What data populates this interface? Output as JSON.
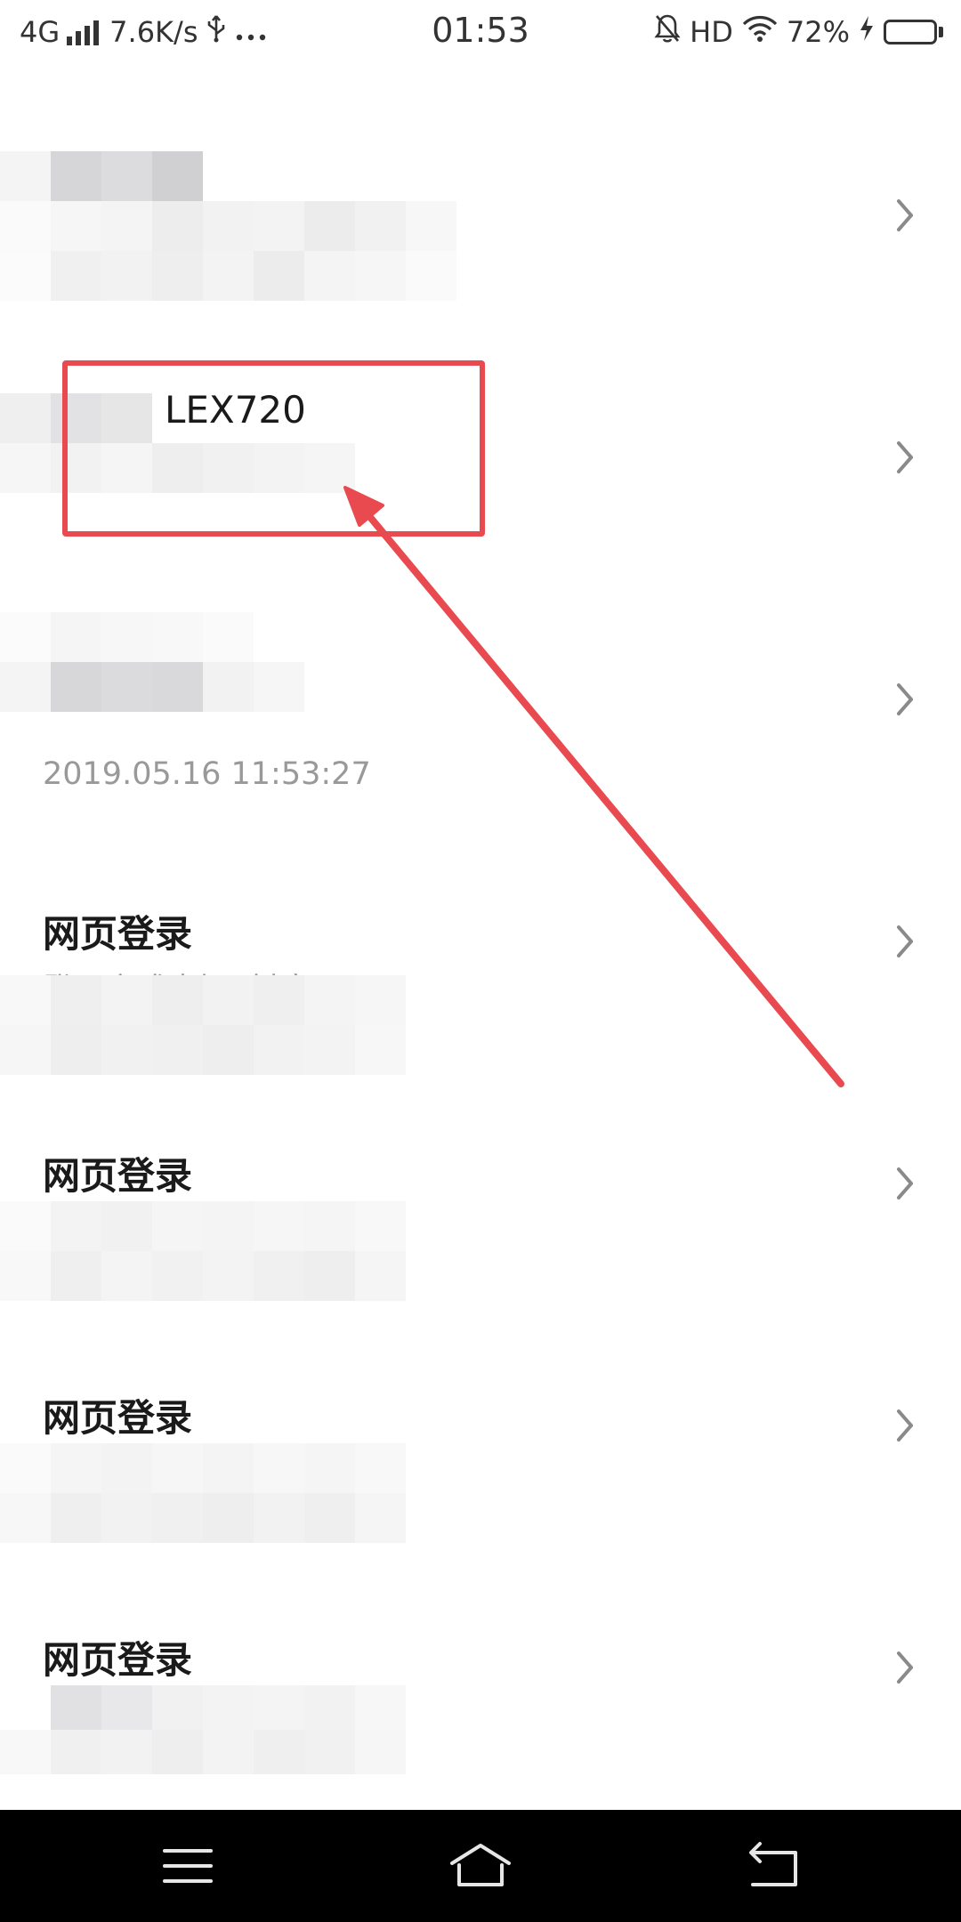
{
  "status_bar": {
    "network": "4G",
    "speed": "7.6K/s",
    "usb_icon": "usb-icon",
    "more_icon": "more-dots-icon",
    "time": "01:53",
    "mute_icon": "bell-off-icon",
    "hd": "HD",
    "wifi_icon": "wifi-icon",
    "battery_text": "72%",
    "charging_icon": "lightning-icon",
    "battery_level": 0.72
  },
  "login_records": [
    {
      "title": "",
      "device": "",
      "time": ""
    },
    {
      "title": "",
      "device": "LEX720",
      "time": ""
    },
    {
      "title": "",
      "device": "",
      "time": "2019.05.16 11:53:27"
    },
    {
      "title": "网页登录",
      "subtitle": "登录方式未知, 抖音",
      "time": ""
    },
    {
      "title": "网页登录",
      "subtitle": "",
      "time": ""
    },
    {
      "title": "网页登录",
      "subtitle": "",
      "time": ""
    },
    {
      "title": "网页登录",
      "subtitle": "",
      "time": ""
    }
  ],
  "annotation": {
    "color": "#e84a50"
  },
  "nav_bar": {
    "menu_icon": "menu-icon",
    "home_icon": "home-icon",
    "back_icon": "back-icon"
  },
  "colors": {
    "title_text": "#1a1a1a",
    "secondary_text": "#999999",
    "chevron": "#8a8a8a",
    "annotation": "#e84a50"
  }
}
